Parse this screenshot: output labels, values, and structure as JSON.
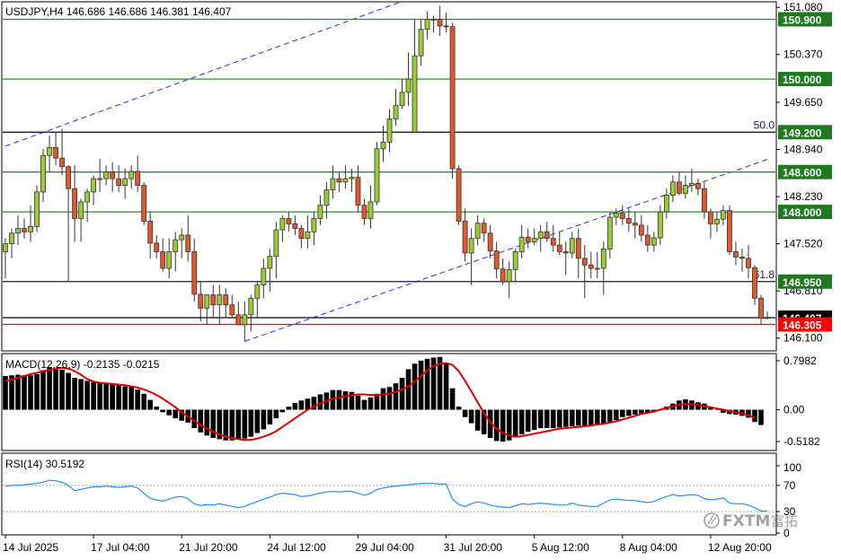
{
  "chart_data": {
    "type": "candlestick",
    "symbol_header": "USDJPY,H4  146.686 146.686 146.381 146.407",
    "ohlc_header": {
      "symbol": "USDJPY",
      "timeframe": "H4",
      "open": 146.686,
      "high": 146.686,
      "low": 146.381,
      "close": 146.407
    },
    "price_axis": {
      "range": [
        145.92,
        151.15
      ],
      "tick_labels": [
        "151.080",
        "150.370",
        "149.650",
        "148.940",
        "148.230",
        "147.520",
        "146.810",
        "146.100"
      ],
      "tick_values": [
        151.08,
        150.37,
        149.65,
        148.94,
        148.23,
        147.52,
        146.81,
        146.1
      ]
    },
    "time_axis": {
      "labels": [
        "14 Jul 2025",
        "17 Jul 04:00",
        "21 Jul 20:00",
        "24 Jul 12:00",
        "29 Jul 04:00",
        "31 Jul 20:00",
        "5 Aug 12:00",
        "8 Aug 04:00",
        "12 Aug 20:00"
      ],
      "label_bar_index": [
        0,
        14,
        28,
        42,
        56,
        70,
        84,
        98,
        112
      ]
    },
    "horizontal_levels": [
      {
        "label": "150.900",
        "value": 150.9,
        "color": "#2e8b2e",
        "label_style": "green-box"
      },
      {
        "label": "150.000",
        "value": 150.0,
        "color": "#2e8b2e",
        "label_style": "green-box"
      },
      {
        "label": "149.200",
        "value": 149.2,
        "color": "#1a1a4a",
        "label_style": "green-box"
      },
      {
        "label": "148.600",
        "value": 148.6,
        "color": "#2e8b2e",
        "label_style": "green-box"
      },
      {
        "label": "148.000",
        "value": 148.0,
        "color": "#2e8b2e",
        "label_style": "green-box"
      },
      {
        "label": "146.950",
        "value": 146.95,
        "color": "#1a1a4a",
        "label_style": "green-box"
      },
      {
        "label": "146.407",
        "value": 146.407,
        "color": "#000000",
        "label_style": "black-box"
      },
      {
        "label": "146.305",
        "value": 146.305,
        "color": "#ff0000",
        "label_style": "red-box"
      }
    ],
    "fibonacci_labels": [
      {
        "text": "50.0",
        "value": 149.2
      },
      {
        "text": "61.8",
        "value": 146.95
      }
    ],
    "channel_lines": [
      {
        "x": [
          0,
          63
        ],
        "y": [
          148.99,
          151.17
        ]
      },
      {
        "x": [
          38,
          121
        ],
        "y": [
          146.05,
          148.79
        ]
      }
    ],
    "candles": {
      "open": [
        147.4,
        147.52,
        147.68,
        147.75,
        147.7,
        147.78,
        148.3,
        148.85,
        148.97,
        148.81,
        148.68,
        148.35,
        147.9,
        148.15,
        148.3,
        148.5,
        148.5,
        148.6,
        148.5,
        148.4,
        148.5,
        148.61,
        148.4,
        147.86,
        147.53,
        147.4,
        147.15,
        147.4,
        147.58,
        147.65,
        147.4,
        146.76,
        146.55,
        146.75,
        146.6,
        146.75,
        146.6,
        146.45,
        146.3,
        146.45,
        146.7,
        146.9,
        147.15,
        147.33,
        147.73,
        147.9,
        147.82,
        147.75,
        147.6,
        147.7,
        147.9,
        148.1,
        148.33,
        148.5,
        148.45,
        148.5,
        148.52,
        148.1,
        147.9,
        148.15,
        148.95,
        149.05,
        149.4,
        149.6,
        149.8,
        149.2,
        150.35,
        150.75,
        150.9,
        150.9,
        150.8,
        150.79,
        148.65,
        147.86,
        147.38,
        147.6,
        147.83,
        147.68,
        147.41,
        147.14,
        146.95,
        147.13,
        147.4,
        147.62,
        147.55,
        147.6,
        147.7,
        147.6,
        147.5,
        147.4,
        147.38,
        147.6,
        147.3,
        147.2,
        147.15,
        147.15,
        147.44,
        147.92,
        147.98,
        147.9,
        147.83,
        147.8,
        147.65,
        147.5,
        147.61,
        148.0,
        148.25,
        148.45,
        148.28,
        148.4,
        148.43,
        148.35,
        148.0,
        147.82,
        147.89,
        148.02,
        147.4,
        147.32,
        147.3,
        147.16,
        146.7,
        146.4
      ],
      "high": [
        147.6,
        147.75,
        147.95,
        147.9,
        148.1,
        148.4,
        148.95,
        149.15,
        149.2,
        149.25,
        148.7,
        148.7,
        148.2,
        148.35,
        148.55,
        148.8,
        148.7,
        148.75,
        148.7,
        148.65,
        148.7,
        148.85,
        148.45,
        148.0,
        147.65,
        147.6,
        147.6,
        147.7,
        147.75,
        147.95,
        147.6,
        146.95,
        146.75,
        146.9,
        146.9,
        146.85,
        146.75,
        146.65,
        146.65,
        146.75,
        146.95,
        147.3,
        147.45,
        147.85,
        147.95,
        148.0,
        147.95,
        147.8,
        147.95,
        148.0,
        148.25,
        148.45,
        148.7,
        148.6,
        148.7,
        148.65,
        148.7,
        148.2,
        148.4,
        149.05,
        149.3,
        149.55,
        149.85,
        150.0,
        150.4,
        150.9,
        150.9,
        151.02,
        150.95,
        151.1,
        151.0,
        150.85,
        148.7,
        148.05,
        147.75,
        147.95,
        147.9,
        147.8,
        147.55,
        147.3,
        147.25,
        147.45,
        147.8,
        147.75,
        147.75,
        147.8,
        147.85,
        147.8,
        147.7,
        147.55,
        147.7,
        147.75,
        147.5,
        147.4,
        147.4,
        147.55,
        148.0,
        148.05,
        148.1,
        148.05,
        148.0,
        147.95,
        147.8,
        147.7,
        148.1,
        148.35,
        148.55,
        148.6,
        148.55,
        148.65,
        148.5,
        148.45,
        148.05,
        148.0,
        148.1,
        148.1,
        147.55,
        147.45,
        147.5,
        147.2,
        146.75,
        146.5
      ],
      "low": [
        147.0,
        147.3,
        147.5,
        147.6,
        147.55,
        147.7,
        148.15,
        148.6,
        148.7,
        148.55,
        146.95,
        147.55,
        147.55,
        147.85,
        148.1,
        148.3,
        148.4,
        148.3,
        148.3,
        148.2,
        148.35,
        148.3,
        147.8,
        147.3,
        147.3,
        147.1,
        147.0,
        147.1,
        147.3,
        147.25,
        146.65,
        146.35,
        146.3,
        146.4,
        146.3,
        146.4,
        146.4,
        146.3,
        146.05,
        146.2,
        146.4,
        146.7,
        146.8,
        147.0,
        147.55,
        147.7,
        147.65,
        147.45,
        147.45,
        147.5,
        147.8,
        147.9,
        148.2,
        148.3,
        148.35,
        148.3,
        148.0,
        147.8,
        147.75,
        148.1,
        148.75,
        148.9,
        149.3,
        149.55,
        149.6,
        149.2,
        150.2,
        150.6,
        150.7,
        150.65,
        150.7,
        148.5,
        147.8,
        147.25,
        146.9,
        147.5,
        147.55,
        147.3,
        147.0,
        146.9,
        146.7,
        146.95,
        147.3,
        147.45,
        147.5,
        147.4,
        147.55,
        147.4,
        147.35,
        147.05,
        147.3,
        147.0,
        146.7,
        147.0,
        147.0,
        146.75,
        147.3,
        147.8,
        147.8,
        147.7,
        147.6,
        147.55,
        147.4,
        147.4,
        147.5,
        147.9,
        148.15,
        148.25,
        148.2,
        148.3,
        148.25,
        147.9,
        147.6,
        147.7,
        147.8,
        147.35,
        147.2,
        147.1,
        147.0,
        146.6,
        146.3,
        146.38
      ],
      "close": [
        147.52,
        147.68,
        147.75,
        147.7,
        147.78,
        148.3,
        148.85,
        148.97,
        148.81,
        148.68,
        148.35,
        147.9,
        148.15,
        148.3,
        148.5,
        148.5,
        148.6,
        148.5,
        148.4,
        148.5,
        148.61,
        148.4,
        147.86,
        147.53,
        147.4,
        147.15,
        147.4,
        147.58,
        147.65,
        147.4,
        146.76,
        146.55,
        146.75,
        146.6,
        146.75,
        146.6,
        146.45,
        146.3,
        146.45,
        146.7,
        146.9,
        147.15,
        147.33,
        147.73,
        147.9,
        147.82,
        147.75,
        147.6,
        147.7,
        147.9,
        148.1,
        148.33,
        148.5,
        148.45,
        148.5,
        148.52,
        148.1,
        147.9,
        148.15,
        148.95,
        149.05,
        149.4,
        149.6,
        149.8,
        150.0,
        150.35,
        150.75,
        150.9,
        150.9,
        150.8,
        150.79,
        148.65,
        147.86,
        147.38,
        147.6,
        147.83,
        147.68,
        147.41,
        147.14,
        146.95,
        147.13,
        147.4,
        147.62,
        147.55,
        147.6,
        147.7,
        147.6,
        147.5,
        147.4,
        147.38,
        147.6,
        147.3,
        147.2,
        147.15,
        147.15,
        147.44,
        147.92,
        147.98,
        147.9,
        147.83,
        147.8,
        147.65,
        147.5,
        147.61,
        148.0,
        148.25,
        148.45,
        148.28,
        148.4,
        148.43,
        148.35,
        148.0,
        147.82,
        147.89,
        148.02,
        147.4,
        147.32,
        147.3,
        147.16,
        146.7,
        146.4,
        146.41
      ]
    },
    "macd": {
      "title": "MACD(12,26,9) -0.2135 -0.0215",
      "params": "12,26,9",
      "main": -0.2135,
      "signal_value": -0.0215,
      "axis_labels": [
        "0.7982",
        "0.00",
        "-0.5182"
      ],
      "axis_values": [
        0.7982,
        0.0,
        -0.5182
      ],
      "range": [
        -0.65,
        0.9
      ],
      "histogram": [
        0.55,
        0.56,
        0.57,
        0.56,
        0.56,
        0.58,
        0.64,
        0.69,
        0.68,
        0.65,
        0.6,
        0.52,
        0.5,
        0.47,
        0.45,
        0.44,
        0.43,
        0.42,
        0.4,
        0.38,
        0.37,
        0.33,
        0.26,
        0.16,
        0.05,
        -0.04,
        -0.09,
        -0.14,
        -0.18,
        -0.21,
        -0.3,
        -0.37,
        -0.42,
        -0.46,
        -0.48,
        -0.5,
        -0.5,
        -0.48,
        -0.47,
        -0.44,
        -0.38,
        -0.32,
        -0.24,
        -0.14,
        -0.04,
        0.05,
        0.11,
        0.15,
        0.18,
        0.21,
        0.25,
        0.28,
        0.32,
        0.32,
        0.3,
        0.29,
        0.23,
        0.16,
        0.2,
        0.26,
        0.35,
        0.37,
        0.43,
        0.52,
        0.66,
        0.75,
        0.8,
        0.83,
        0.85,
        0.86,
        0.75,
        0.35,
        0.05,
        -0.12,
        -0.22,
        -0.34,
        -0.4,
        -0.46,
        -0.51,
        -0.52,
        -0.5,
        -0.45,
        -0.4,
        -0.36,
        -0.33,
        -0.3,
        -0.3,
        -0.3,
        -0.29,
        -0.28,
        -0.27,
        -0.26,
        -0.26,
        -0.25,
        -0.24,
        -0.22,
        -0.2,
        -0.17,
        -0.12,
        -0.1,
        -0.08,
        -0.06,
        -0.05,
        -0.03,
        0.0,
        0.05,
        0.1,
        0.15,
        0.17,
        0.15,
        0.12,
        0.1,
        0.05,
        0.0,
        -0.05,
        -0.07,
        -0.08,
        -0.1,
        -0.13,
        -0.2,
        -0.25
      ],
      "signal": [
        0.47,
        0.49,
        0.52,
        0.55,
        0.58,
        0.6,
        0.63,
        0.65,
        0.67,
        0.68,
        0.67,
        0.63,
        0.57,
        0.5,
        0.46,
        0.44,
        0.43,
        0.42,
        0.41,
        0.4,
        0.38,
        0.36,
        0.33,
        0.29,
        0.24,
        0.18,
        0.11,
        0.04,
        -0.04,
        -0.11,
        -0.18,
        -0.25,
        -0.31,
        -0.36,
        -0.4,
        -0.44,
        -0.46,
        -0.48,
        -0.49,
        -0.49,
        -0.47,
        -0.44,
        -0.4,
        -0.35,
        -0.28,
        -0.21,
        -0.14,
        -0.07,
        0.0,
        0.05,
        0.1,
        0.14,
        0.18,
        0.2,
        0.22,
        0.24,
        0.25,
        0.25,
        0.24,
        0.24,
        0.25,
        0.26,
        0.29,
        0.33,
        0.38,
        0.46,
        0.55,
        0.64,
        0.71,
        0.75,
        0.76,
        0.73,
        0.63,
        0.47,
        0.3,
        0.12,
        -0.05,
        -0.2,
        -0.31,
        -0.38,
        -0.42,
        -0.44,
        -0.43,
        -0.41,
        -0.39,
        -0.37,
        -0.35,
        -0.33,
        -0.31,
        -0.3,
        -0.29,
        -0.28,
        -0.27,
        -0.26,
        -0.24,
        -0.23,
        -0.21,
        -0.19,
        -0.16,
        -0.13,
        -0.1,
        -0.07,
        -0.05,
        -0.03,
        0.0,
        0.03,
        0.06,
        0.08,
        0.09,
        0.09,
        0.08,
        0.06,
        0.04,
        0.02,
        0.0,
        -0.02,
        -0.04,
        -0.06,
        -0.09,
        -0.13
      ]
    },
    "rsi": {
      "title": "RSI(14) 30.5192",
      "period": 14,
      "value": 30.5192,
      "axis_labels": [
        "100",
        "70",
        "30",
        "0"
      ],
      "axis_values": [
        100,
        70,
        30,
        0
      ],
      "levels": [
        70,
        30
      ],
      "values": [
        69,
        70,
        70,
        71,
        72,
        73,
        75,
        78,
        77,
        75,
        70,
        62,
        64,
        66,
        68,
        68,
        69,
        68,
        67,
        68,
        69,
        66,
        58,
        50,
        48,
        46,
        49,
        52,
        53,
        50,
        42,
        39,
        41,
        40,
        42,
        40,
        38,
        36,
        38,
        42,
        45,
        49,
        52,
        56,
        58,
        57,
        56,
        53,
        54,
        56,
        58,
        60,
        61,
        60,
        61,
        61,
        58,
        55,
        58,
        64,
        66,
        68,
        69,
        70,
        71,
        72,
        73,
        73,
        73,
        72,
        72,
        49,
        41,
        38,
        42,
        45,
        43,
        40,
        38,
        37,
        36,
        39,
        42,
        41,
        42,
        43,
        42,
        41,
        40,
        40,
        43,
        40,
        39,
        38,
        38,
        43,
        48,
        49,
        48,
        47,
        47,
        45,
        44,
        45,
        50,
        53,
        56,
        54,
        55,
        56,
        55,
        50,
        48,
        49,
        51,
        43,
        42,
        42,
        40,
        36,
        31,
        30.5
      ]
    }
  },
  "watermark": {
    "icon": "fxtm-logo-icon",
    "text": "FXTM",
    "cjk_text": "富拓"
  }
}
